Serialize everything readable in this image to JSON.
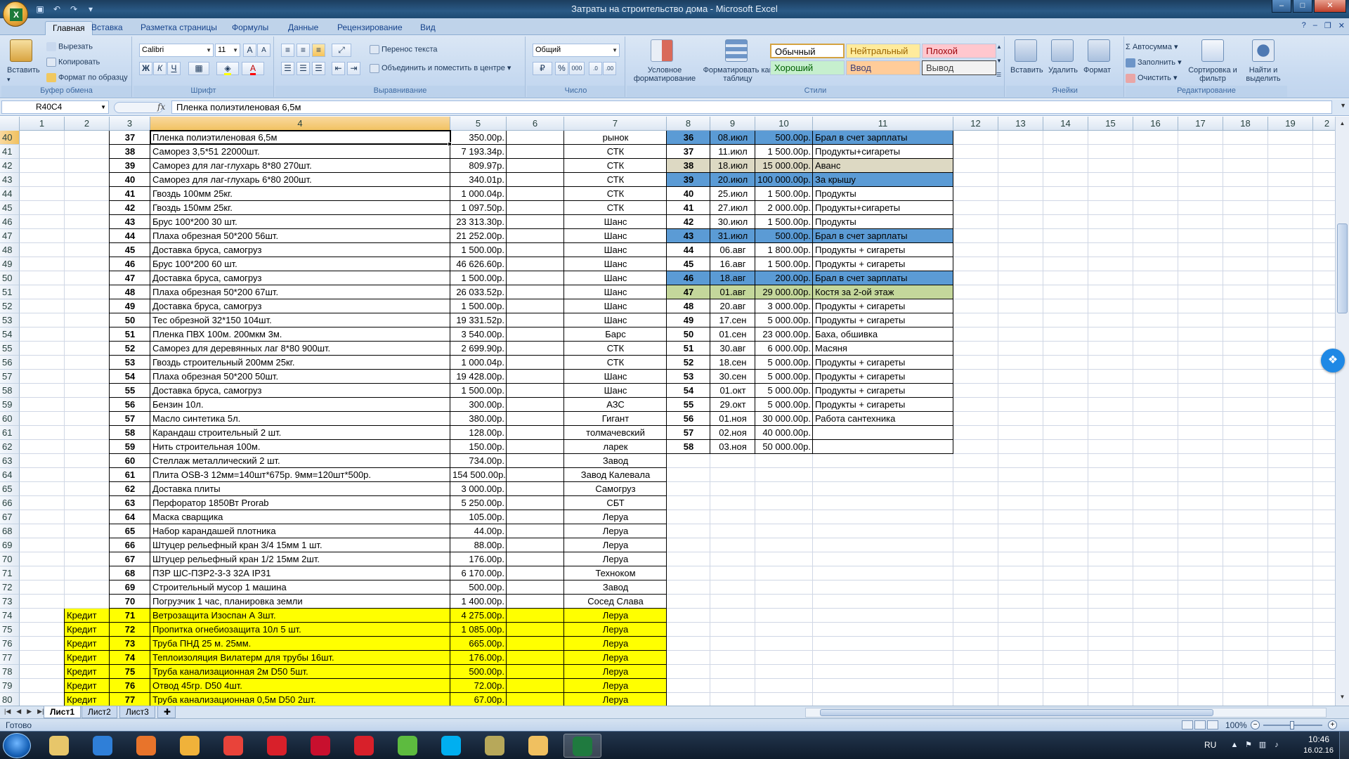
{
  "window": {
    "title": "Затраты на строительство дома - Microsoft Excel"
  },
  "icons": {
    "app": "excel-orb-icon",
    "save": "save-icon",
    "undo": "undo-icon",
    "redo": "redo-icon",
    "qat_more": "customize-qat-icon",
    "minimize": "minimize-icon",
    "maximize": "maximize-icon",
    "close": "close-icon"
  },
  "ribbon": {
    "tabs": [
      "Главная",
      "Вставка",
      "Разметка страницы",
      "Формулы",
      "Данные",
      "Рецензирование",
      "Вид"
    ],
    "active_tab": "Главная",
    "clipboard": {
      "paste": "Вставить",
      "cut": "Вырезать",
      "copy": "Копировать",
      "format_painter": "Формат по образцу",
      "label": "Буфер обмена"
    },
    "font": {
      "name": "Calibri",
      "size": "11",
      "bold": "Ж",
      "italic": "К",
      "underline": "Ч",
      "grow": "A",
      "shrink": "A",
      "font_color_letter": "A",
      "label": "Шрифт"
    },
    "alignment": {
      "wrap_text": "Перенос текста",
      "merge_center": "Объединить и поместить в центре",
      "label": "Выравнивание"
    },
    "number": {
      "format": "Общий",
      "percent": "%",
      "thousands": "000",
      "label": "Число"
    },
    "styles": {
      "conditional": "Условное форматирование",
      "format_table": "Форматировать как таблицу",
      "cells": [
        {
          "name": "Обычный",
          "bg": "#ffffff",
          "fg": "#000000"
        },
        {
          "name": "Нейтральный",
          "bg": "#ffeb9c",
          "fg": "#9c6500"
        },
        {
          "name": "Плохой",
          "bg": "#ffc7ce",
          "fg": "#9c0006"
        },
        {
          "name": "Хороший",
          "bg": "#c6efce",
          "fg": "#006100"
        },
        {
          "name": "Ввод",
          "bg": "#ffcc99",
          "fg": "#3f3f76"
        },
        {
          "name": "Вывод",
          "bg": "#f2f2f2",
          "fg": "#3f3f3f"
        }
      ],
      "label": "Стили"
    },
    "cells": {
      "insert": "Вставить",
      "delete": "Удалить",
      "format": "Формат",
      "label": "Ячейки"
    },
    "editing": {
      "autosum": "Автосумма",
      "fill": "Заполнить",
      "clear": "Очистить",
      "sort_filter": "Сортировка и фильтр",
      "find_select": "Найти и выделить",
      "label": "Редактирование"
    }
  },
  "formula_bar": {
    "name_box": "R40C4",
    "fx": "fx",
    "content": "Пленка полиэтиленовая 6,5м"
  },
  "grid": {
    "columns": [
      "1",
      "2",
      "3",
      "4",
      "5",
      "6",
      "7",
      "8",
      "9",
      "10",
      "11",
      "12",
      "13",
      "14",
      "15",
      "16",
      "17",
      "18",
      "19",
      "2"
    ],
    "selected_column": "4",
    "selected_row": 40,
    "first_row": 40,
    "left_table": [
      {
        "row": 40,
        "num": "37",
        "item": "Пленка полиэтиленовая 6,5м",
        "price": "350.00р.",
        "store": "рынок"
      },
      {
        "row": 41,
        "num": "38",
        "item": "Саморез 3,5*51 22000шт.",
        "price": "7 193.34р.",
        "store": "СТК"
      },
      {
        "row": 42,
        "num": "39",
        "item": "Саморез для лаг-глухарь 8*80 270шт.",
        "price": "809.97р.",
        "store": "СТК"
      },
      {
        "row": 43,
        "num": "40",
        "item": "Саморез для лаг-глухарь 6*80 200шт.",
        "price": "340.01р.",
        "store": "СТК"
      },
      {
        "row": 44,
        "num": "41",
        "item": "Гвоздь 100мм 25кг.",
        "price": "1 000.04р.",
        "store": "СТК"
      },
      {
        "row": 45,
        "num": "42",
        "item": "Гвоздь 150мм 25кг.",
        "price": "1 097.50р.",
        "store": "СТК"
      },
      {
        "row": 46,
        "num": "43",
        "item": "Брус 100*200 30 шт.",
        "price": "23 313.30р.",
        "store": "Шанс"
      },
      {
        "row": 47,
        "num": "44",
        "item": "Плаха обрезная 50*200 56шт.",
        "price": "21 252.00р.",
        "store": "Шанс"
      },
      {
        "row": 48,
        "num": "45",
        "item": "Доставка бруса, самогруз",
        "price": "1 500.00р.",
        "store": "Шанс"
      },
      {
        "row": 49,
        "num": "46",
        "item": "Брус 100*200 60 шт.",
        "price": "46 626.60р.",
        "store": "Шанс"
      },
      {
        "row": 50,
        "num": "47",
        "item": "Доставка бруса, самогруз",
        "price": "1 500.00р.",
        "store": "Шанс"
      },
      {
        "row": 51,
        "num": "48",
        "item": "Плаха обрезная 50*200 67шт.",
        "price": "26 033.52р.",
        "store": "Шанс"
      },
      {
        "row": 52,
        "num": "49",
        "item": "Доставка бруса, самогруз",
        "price": "1 500.00р.",
        "store": "Шанс"
      },
      {
        "row": 53,
        "num": "50",
        "item": "Тес обрезной 32*150 104шт.",
        "price": "19 331.52р.",
        "store": "Шанс"
      },
      {
        "row": 54,
        "num": "51",
        "item": "Пленка ПВХ 100м. 200мкм 3м.",
        "price": "3 540.00р.",
        "store": "Барс"
      },
      {
        "row": 55,
        "num": "52",
        "item": "Саморез для деревянных лаг 8*80 900шт.",
        "price": "2 699.90р.",
        "store": "СТК"
      },
      {
        "row": 56,
        "num": "53",
        "item": "Гвоздь строительный 200мм  25кг.",
        "price": "1 000.04р.",
        "store": "СТК"
      },
      {
        "row": 57,
        "num": "54",
        "item": "Плаха обрезная 50*200 50шт.",
        "price": "19 428.00р.",
        "store": "Шанс"
      },
      {
        "row": 58,
        "num": "55",
        "item": "Доставка бруса, самогруз",
        "price": "1 500.00р.",
        "store": "Шанс"
      },
      {
        "row": 59,
        "num": "56",
        "item": "Бензин 10л.",
        "price": "300.00р.",
        "store": "АЗС"
      },
      {
        "row": 60,
        "num": "57",
        "item": "Масло синтетика 5л.",
        "price": "380.00р.",
        "store": "Гигант"
      },
      {
        "row": 61,
        "num": "58",
        "item": "Карандаш строительный 2 шт.",
        "price": "128.00р.",
        "store": "толмачевский"
      },
      {
        "row": 62,
        "num": "59",
        "item": "Нить строительная 100м.",
        "price": "150.00р.",
        "store": "ларек"
      },
      {
        "row": 63,
        "num": "60",
        "item": "Стеллаж металлический 2 шт.",
        "price": "734.00р.",
        "store": "Завод"
      },
      {
        "row": 64,
        "num": "61",
        "item": "Плита OSB-3  12мм=140шт*675р.  9мм=120шт*500р.",
        "price": "154 500.00р.",
        "store": "Завод Калевала"
      },
      {
        "row": 65,
        "num": "62",
        "item": "Доставка плиты",
        "price": "3 000.00р.",
        "store": "Самогруз"
      },
      {
        "row": 66,
        "num": "63",
        "item": "Перфоратор 1850Вт Prorab",
        "price": "5 250.00р.",
        "store": "СБТ"
      },
      {
        "row": 67,
        "num": "64",
        "item": "Маска сварщика",
        "price": "105.00р.",
        "store": "Леруа"
      },
      {
        "row": 68,
        "num": "65",
        "item": "Набор карандашей плотника",
        "price": "44.00р.",
        "store": "Леруа"
      },
      {
        "row": 69,
        "num": "66",
        "item": "Штуцер рельефный кран 3/4 15мм  1 шт.",
        "price": "88.00р.",
        "store": "Леруа"
      },
      {
        "row": 70,
        "num": "67",
        "item": "Штуцер рельефный кран 1/2 15мм 2шт.",
        "price": "176.00р.",
        "store": "Леруа"
      },
      {
        "row": 71,
        "num": "68",
        "item": "ПЗР ШС-ПЗР2-3-3 32А IP31",
        "price": "6 170.00р.",
        "store": "Техноком"
      },
      {
        "row": 72,
        "num": "69",
        "item": "Строительный мусор 1 машина",
        "price": "500.00р.",
        "store": "Завод"
      },
      {
        "row": 73,
        "num": "70",
        "item": "Погрузчик 1 час, планировка земли",
        "price": "1 400.00р.",
        "store": "Сосед Слава"
      },
      {
        "row": 74,
        "credit": "Кредит",
        "num": "71",
        "item": "Ветрозащита Изоспан А 3шт.",
        "price": "4 275.00р.",
        "store": "Леруа"
      },
      {
        "row": 75,
        "credit": "Кредит",
        "num": "72",
        "item": "Пропитка огнебиозащита 10л 5 шт.",
        "price": "1 085.00р.",
        "store": "Леруа"
      },
      {
        "row": 76,
        "credit": "Кредит",
        "num": "73",
        "item": "Труба ПНД 25 м. 25мм.",
        "price": "665.00р.",
        "store": "Леруа"
      },
      {
        "row": 77,
        "credit": "Кредит",
        "num": "74",
        "item": "Теплоизоляция Вилатерм для трубы 16шт.",
        "price": "176.00р.",
        "store": "Леруа"
      },
      {
        "row": 78,
        "credit": "Кредит",
        "num": "75",
        "item": "Труба канализационная 2м D50  5шт.",
        "price": "500.00р.",
        "store": "Леруа"
      },
      {
        "row": 79,
        "credit": "Кредит",
        "num": "76",
        "item": "Отвод 45гр. D50 4шт.",
        "price": "72.00р.",
        "store": "Леруа"
      },
      {
        "row": 80,
        "credit": "Кредит",
        "num": "77",
        "item": "Труба канализационная 0,5м D50  2шт.",
        "price": "67.00р.",
        "store": "Леруа"
      }
    ],
    "right_table": [
      {
        "row": 40,
        "num": "36",
        "date": "08.июл",
        "amount": "500.00р.",
        "note": "Брал в счет зарплаты",
        "color": "#5b9bd5"
      },
      {
        "row": 41,
        "num": "37",
        "date": "11.июл",
        "amount": "1 500.00р.",
        "note": "Продукты+сигареты",
        "color": ""
      },
      {
        "row": 42,
        "num": "38",
        "date": "18.июл",
        "amount": "15 000.00р.",
        "note": "Аванс",
        "color": "#ddd9c3"
      },
      {
        "row": 43,
        "num": "39",
        "date": "20.июл",
        "amount": "100 000.00р.",
        "note": "За крышу",
        "color": "#5b9bd5"
      },
      {
        "row": 44,
        "num": "40",
        "date": "25.июл",
        "amount": "1 500.00р.",
        "note": "Продукты",
        "color": ""
      },
      {
        "row": 45,
        "num": "41",
        "date": "27.июл",
        "amount": "2 000.00р.",
        "note": "Продукты+сигареты",
        "color": ""
      },
      {
        "row": 46,
        "num": "42",
        "date": "30.июл",
        "amount": "1 500.00р.",
        "note": "Продукты",
        "color": ""
      },
      {
        "row": 47,
        "num": "43",
        "date": "31.июл",
        "amount": "500.00р.",
        "note": "Брал в счет зарплаты",
        "color": "#5b9bd5"
      },
      {
        "row": 48,
        "num": "44",
        "date": "06.авг",
        "amount": "1 800.00р.",
        "note": "Продукты + сигареты",
        "color": ""
      },
      {
        "row": 49,
        "num": "45",
        "date": "16.авг",
        "amount": "1 500.00р.",
        "note": "Продукты + сигареты",
        "color": ""
      },
      {
        "row": 50,
        "num": "46",
        "date": "18.авг",
        "amount": "200.00р.",
        "note": "Брал в счет зарплаты",
        "color": "#5b9bd5"
      },
      {
        "row": 51,
        "num": "47",
        "date": "01.авг",
        "amount": "29 000.00р.",
        "note": "Костя за 2-ой этаж",
        "color": "#c4d79b"
      },
      {
        "row": 52,
        "num": "48",
        "date": "20.авг",
        "amount": "3 000.00р.",
        "note": "Продукты + сигареты",
        "color": ""
      },
      {
        "row": 53,
        "num": "49",
        "date": "17.сен",
        "amount": "5 000.00р.",
        "note": "Продукты + сигареты",
        "color": ""
      },
      {
        "row": 54,
        "num": "50",
        "date": "01.сен",
        "amount": "23 000.00р.",
        "note": "Баха, обшивка",
        "color": ""
      },
      {
        "row": 55,
        "num": "51",
        "date": "30.авг",
        "amount": "6 000.00р.",
        "note": "Масяня",
        "color": ""
      },
      {
        "row": 56,
        "num": "52",
        "date": "18.сен",
        "amount": "5 000.00р.",
        "note": "Продукты + сигареты",
        "color": ""
      },
      {
        "row": 57,
        "num": "53",
        "date": "30.сен",
        "amount": "5 000.00р.",
        "note": "Продукты + сигареты",
        "color": ""
      },
      {
        "row": 58,
        "num": "54",
        "date": "01.окт",
        "amount": "5 000.00р.",
        "note": "Продукты + сигареты",
        "color": ""
      },
      {
        "row": 59,
        "num": "55",
        "date": "29.окт",
        "amount": "5 000.00р.",
        "note": "Продукты + сигареты",
        "color": ""
      },
      {
        "row": 60,
        "num": "56",
        "date": "01.ноя",
        "amount": "30 000.00р.",
        "note": "Работа сантехника",
        "color": ""
      },
      {
        "row": 61,
        "num": "57",
        "date": "02.ноя",
        "amount": "40 000.00р.",
        "note": "",
        "color": ""
      },
      {
        "row": 62,
        "num": "58",
        "date": "03.ноя",
        "amount": "50 000.00р.",
        "note": "",
        "color": ""
      }
    ],
    "credit_fill": "#ffff00"
  },
  "sheets": [
    "Лист1",
    "Лист2",
    "Лист3"
  ],
  "active_sheet": "Лист1",
  "status": {
    "text": "Готово",
    "zoom": "100%",
    "minus": "−",
    "plus": "+"
  },
  "taskbar": {
    "apps": [
      "explorer-icon",
      "internet-explorer-icon",
      "media-player-icon",
      "paint-icon",
      "chrome-icon",
      "yandex-icon",
      "opera-icon",
      "yandex-browser-icon",
      "utorrent-icon",
      "skype-icon",
      "calculator-icon",
      "outlook-icon",
      "excel-icon"
    ],
    "active_app": "excel-icon",
    "language": "RU",
    "time": "10:46",
    "date": "16.02.16"
  }
}
